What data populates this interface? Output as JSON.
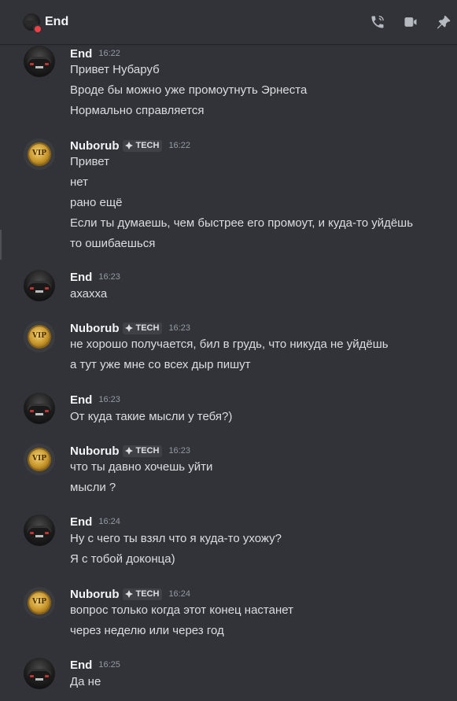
{
  "header": {
    "title": "End",
    "icons": [
      "phone-call-icon",
      "video-camera-icon",
      "pin-icon"
    ]
  },
  "colors": {
    "background": "#313338",
    "text": "#dbdee1",
    "timestamp": "#949ba4",
    "status_dnd": "#f23f43"
  },
  "messages": [
    {
      "author": "End",
      "time": "16:22",
      "lines": [
        "Привет Нубаруб",
        "Вроде бы можно уже промоутнуть Эрнеста",
        "Нормально справляется"
      ]
    },
    {
      "author": "Nuborub",
      "tag": "TECH",
      "time": "16:22",
      "lines": [
        "Привет",
        "нет",
        "рано ещё",
        "Если ты думаешь, чем быстрее его промоут, и куда-то уйдёшь",
        "то ошибаешься"
      ]
    },
    {
      "author": "End",
      "time": "16:23",
      "lines": [
        "ахахха"
      ]
    },
    {
      "author": "Nuborub",
      "tag": "TECH",
      "time": "16:23",
      "lines": [
        "не хорошо получается, бил в грудь, что никуда не уйдёшь",
        "а тут уже мне со всех дыр пишут"
      ]
    },
    {
      "author": "End",
      "time": "16:23",
      "lines": [
        "От куда такие мысли у тебя?)"
      ]
    },
    {
      "author": "Nuborub",
      "tag": "TECH",
      "time": "16:23",
      "lines": [
        "что ты давно хочешь уйти",
        "мысли ?"
      ]
    },
    {
      "author": "End",
      "time": "16:24",
      "lines": [
        "Ну с чего ты взял что я куда-то ухожу?",
        "Я с тобой доконца)"
      ]
    },
    {
      "author": "Nuborub",
      "tag": "TECH",
      "time": "16:24",
      "lines": [
        "вопрос только когда этот конец настанет",
        "через неделю или через год"
      ]
    },
    {
      "author": "End",
      "time": "16:25",
      "lines": [
        "Да не"
      ]
    }
  ],
  "avatar_text": "VIP"
}
